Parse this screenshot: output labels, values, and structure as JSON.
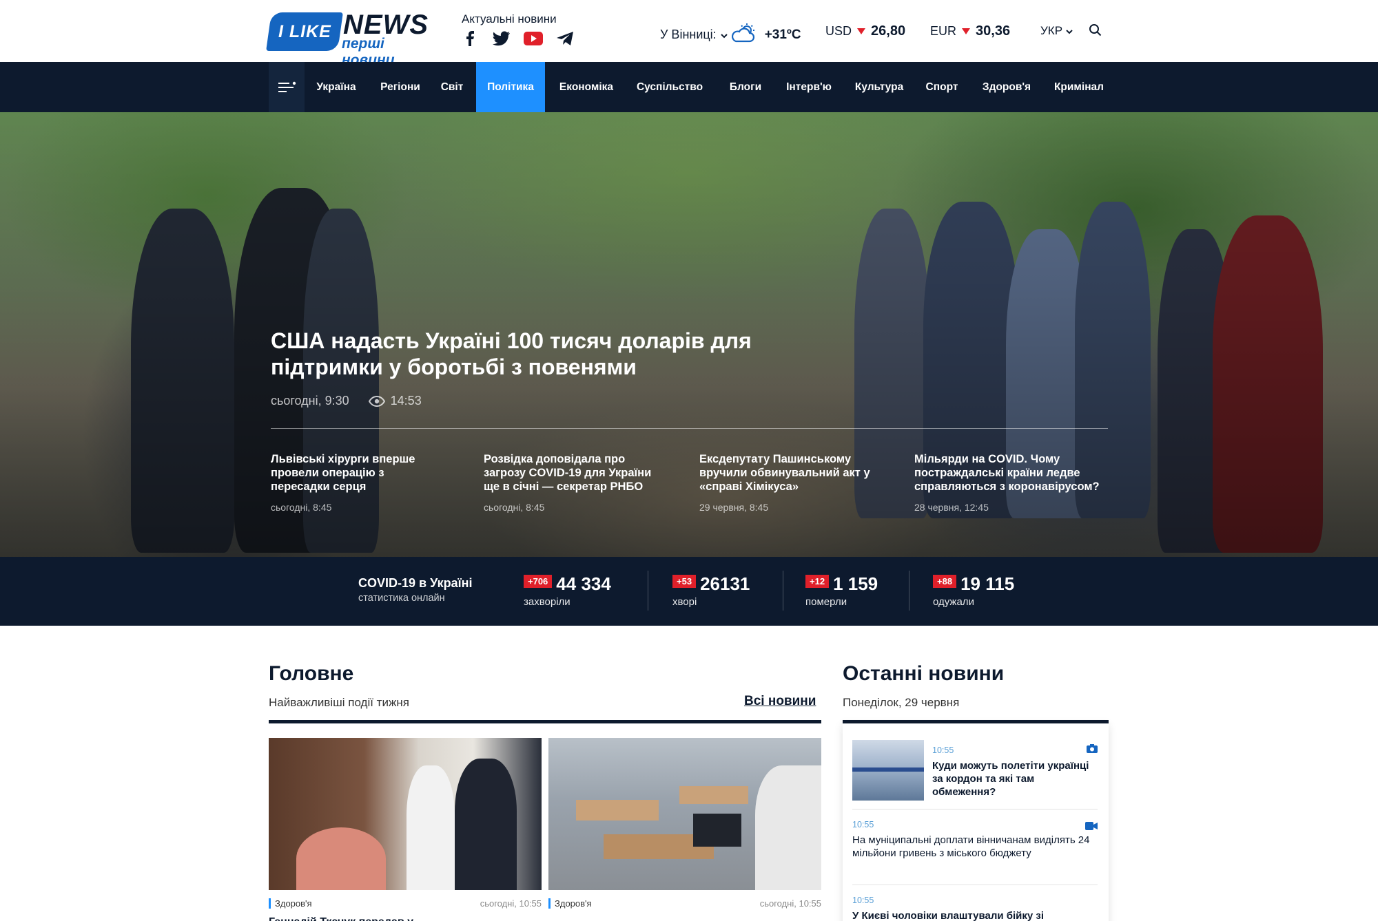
{
  "header": {
    "logo_left": "I LIKE",
    "logo_right": "NEWS",
    "logo_sub": "перші новини",
    "actual_news": "Актуальні новини",
    "city": "У Вінниці:",
    "temperature": "+31ºC",
    "currencies": [
      {
        "code": "USD",
        "value": "26,80"
      },
      {
        "code": "EUR",
        "value": "30,36"
      }
    ],
    "language": "УКР"
  },
  "nav": {
    "items": [
      "Україна",
      "Регіони",
      "Світ",
      "Політика",
      "Економіка",
      "Суспільство",
      "Блоги",
      "Інтерв'ю",
      "Культура",
      "Спорт",
      "Здоров'я",
      "Кримінал"
    ],
    "active": "Політика"
  },
  "hero": {
    "title": "США надасть Україні 100 тисяч доларів для підтримки у боротьбі з повенями",
    "date": "сьогодні, 9:30",
    "views": "14:53",
    "sub_news": [
      {
        "title": "Львівські хірурги вперше провели операцію з пересадки серця",
        "date": "сьогодні, 8:45"
      },
      {
        "title": "Розвідка доповідала про загрозу COVID-19 для України ще в січні — секретар РНБО",
        "date": "сьогодні, 8:45"
      },
      {
        "title": "Ексдепутату Пашинському вручили обвинувальний акт у «справі Хімікуса»",
        "date": "29 червня, 8:45"
      },
      {
        "title": "Мільярди на COVID. Чому постраждалські країни ледве справляються з коронавірусом?",
        "date": "28 червня, 12:45"
      }
    ]
  },
  "covid": {
    "title": "COVID-19 в Україні",
    "subtitle": "статистика онлайн",
    "stats": [
      {
        "delta": "+706",
        "value": "44 334",
        "label": "захворіли"
      },
      {
        "delta": "+53",
        "value": "26131",
        "label": "хворі"
      },
      {
        "delta": "+12",
        "value": "1 159",
        "label": "померли"
      },
      {
        "delta": "+88",
        "value": "19 115",
        "label": "одужали"
      }
    ]
  },
  "main": {
    "title": "Головне",
    "subtitle": "Найважливіші події тижня",
    "all_news": "Всі новини",
    "cards": [
      {
        "category": "Здоров'я",
        "date": "сьогодні, 10:55",
        "title": "Геннадій Ткачук передав у"
      },
      {
        "category": "Здоров'я",
        "date": "сьогодні, 10:55",
        "title": ""
      }
    ]
  },
  "latest": {
    "title": "Останні новини",
    "date": "Понеділок, 29 червня",
    "items": [
      {
        "time": "10:55",
        "title": "Куди можуть полетіти українці за кордон та які там обмеження?",
        "icon": "camera-icon"
      },
      {
        "time": "10:55",
        "title": "На муніципальні доплати вінничанам виділять 24 мільйони гривень з міського бюджету",
        "icon": "video-icon"
      },
      {
        "time": "10:55",
        "title": "У Києві чоловіки влаштували бійку зі",
        "icon": ""
      }
    ]
  },
  "colors": {
    "navy": "#0d1a2e",
    "accent_blue": "#1e90ff",
    "red": "#e0202a",
    "brand_blue": "#1565c0"
  }
}
